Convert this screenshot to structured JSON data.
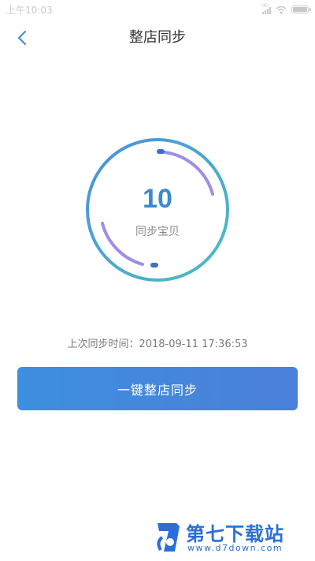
{
  "status_bar": {
    "time": "上午10:03",
    "signal_label": "HD"
  },
  "header": {
    "title": "整店同步",
    "back_icon": "chevron-left-icon"
  },
  "sync_ring": {
    "count": "10",
    "label": "同步宝贝"
  },
  "last_sync": "上次同步时间：2018-09-11 17:36:53",
  "actions": {
    "sync_button_label": "一键整店同步"
  },
  "watermark": {
    "name": "第七下载站",
    "url": "www.d7down.com"
  },
  "colors": {
    "accent_blue": "#3a8ad0",
    "ring_teal": "#4db8c7",
    "ring_purple": "#9b8fe6",
    "button_start": "#3d8fe0",
    "button_end": "#4b7fd9"
  }
}
